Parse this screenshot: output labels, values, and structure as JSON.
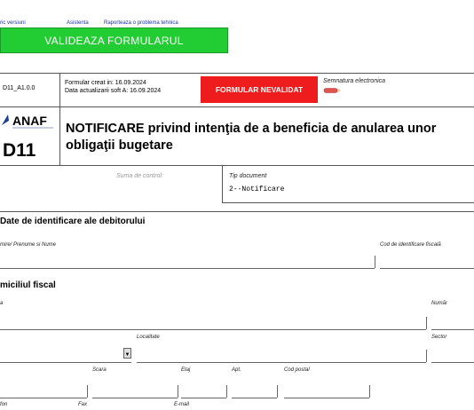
{
  "toplinks": [
    "ric versiuni",
    "Asistenta",
    "Raporteaza o problema tehnica"
  ],
  "validate_label": "VALIDEAZA FORMULARUL",
  "header": {
    "form_version": "D11_A1.0.0",
    "created": "Formular creat in: 16.09.2024",
    "updated": "Data actualizarii soft A: 16.09.2024",
    "status": "FORMULAR NEVALIDAT",
    "signature_label": "Semnatura electronica",
    "status_color": "#ee1c1c"
  },
  "logo_text": "ANAF",
  "title": "NOTIFICARE privind intenţia de a beneficia de anularea unor obligaţii bugetare",
  "form_code": "D11",
  "control": {
    "sum_label": "Suma de control:",
    "doc_type_label": "Tip document",
    "doc_type_value": "2--Notificare"
  },
  "section1": {
    "title": "Date de identificare ale debitorului",
    "name_label": "mire/ Prenume si Nume",
    "cif_label": "Cod de identificare fiscală"
  },
  "section2": {
    "title": "miciliul fiscal",
    "street_label": "a",
    "number_label": "Număr",
    "locality_label": "Localitate",
    "sector_label": "Sector",
    "staircase_label": "Scara",
    "floor_label": "Etaj",
    "apt_label": "Apt.",
    "postal_label": "Cod postal",
    "phone_label": "fon",
    "fax_label": "Fax",
    "email_label": "E-mail"
  },
  "icons": {
    "dropdown": "chevron-down-icon",
    "pen": "pen-icon"
  },
  "colors": {
    "validate": "#22cc33",
    "links": "#1a33a8",
    "logo": "#1c3f94"
  }
}
